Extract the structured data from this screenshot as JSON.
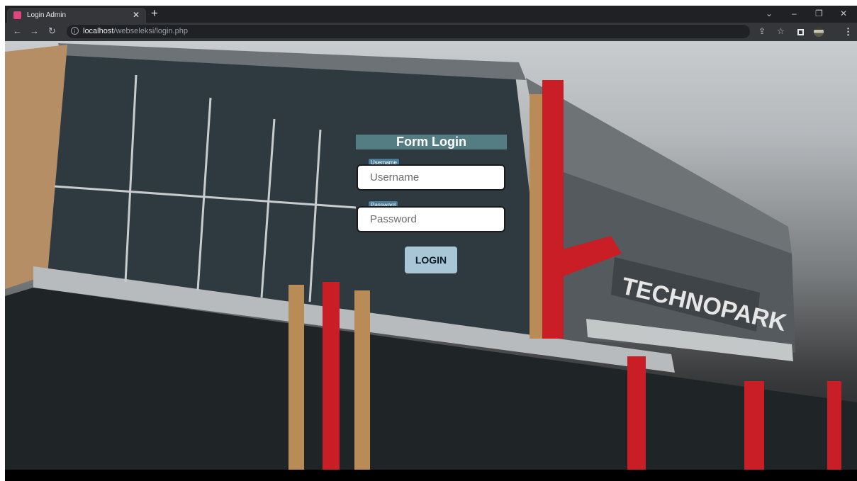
{
  "browser": {
    "tab_title": "Login Admin",
    "tab_close_glyph": "✕",
    "new_tab_glyph": "+",
    "url_host": "localhost",
    "url_path": "/webseleksi/login.php",
    "icons": [
      "back-arrow-icon",
      "forward-arrow-icon",
      "reload-icon",
      "info-icon",
      "share-icon",
      "star-icon",
      "side-panel-icon",
      "profile-avatar",
      "kebab-menu-icon"
    ],
    "window_controls": {
      "tab_search": "⌄",
      "minimize": "–",
      "restore": "❐",
      "close": "✕"
    }
  },
  "form": {
    "title": "Form Login",
    "username_tag": "Username",
    "username_placeholder": "Username",
    "username_value": "",
    "password_tag": "Password",
    "password_placeholder": "Password",
    "password_value": "",
    "login_label": "LOGIN"
  },
  "background": {
    "building_sign": "TECHNOPARK"
  },
  "colors": {
    "title_bar": "#5f9196",
    "field_tag": "#4d7d96",
    "login_button": "#a9c6d6",
    "accent_red": "#c91e26",
    "favicon": "#e0457b"
  }
}
